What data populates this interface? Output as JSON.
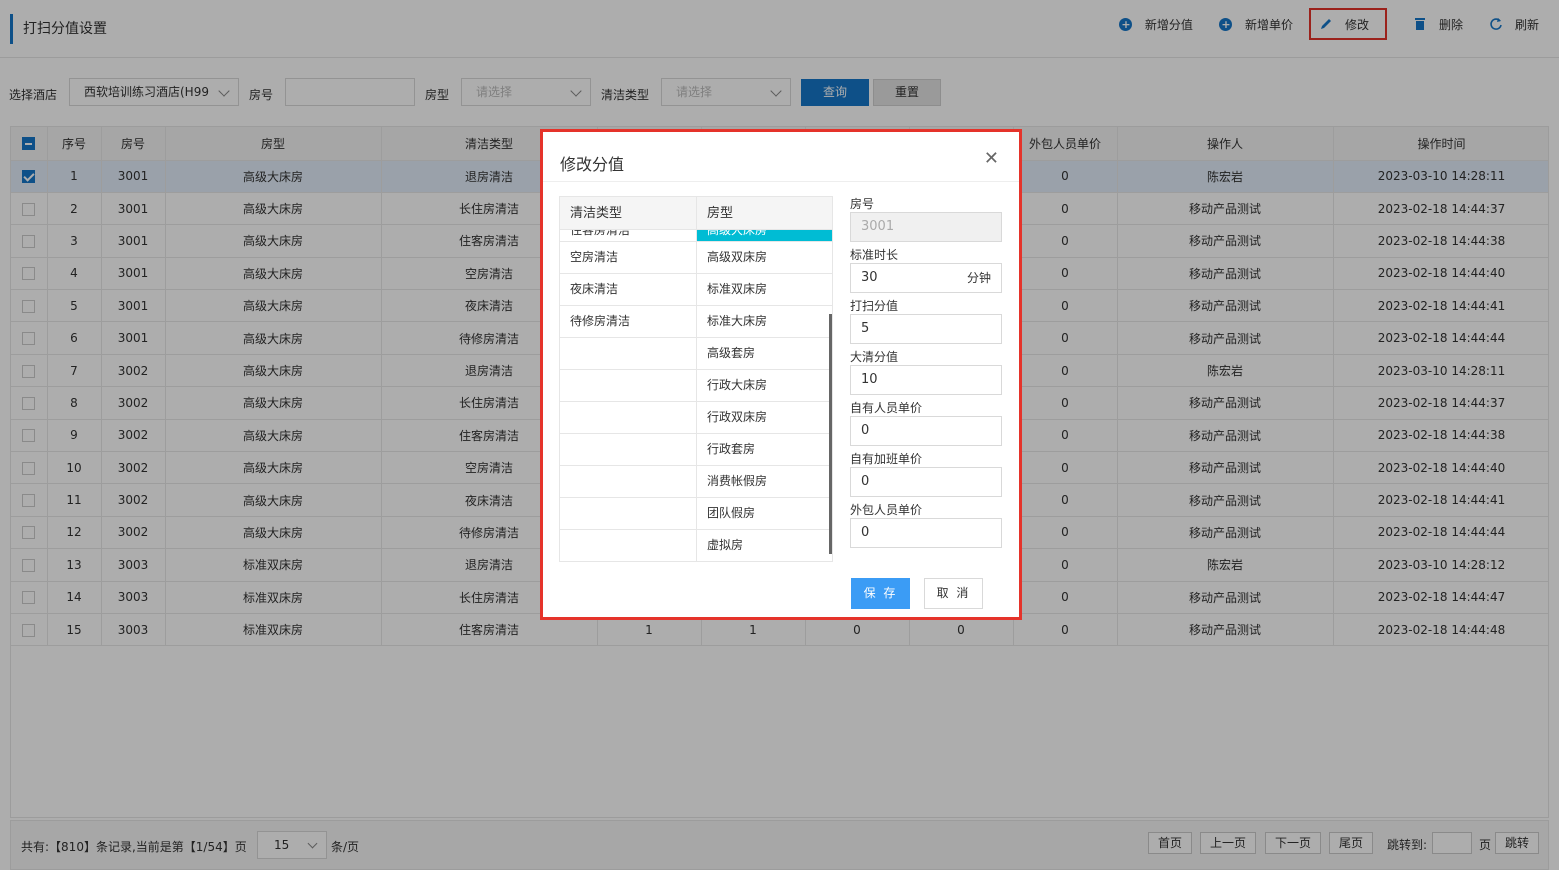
{
  "page": {
    "title": "打扫分值设置"
  },
  "toolbar": {
    "add_score": "新增分值",
    "add_price": "新增单价",
    "edit": "修改",
    "delete": "删除",
    "refresh": "刷新"
  },
  "filter": {
    "hotel_label": "选择酒店",
    "hotel_value": "西软培训练习酒店(H99",
    "room_label": "房号",
    "room_value": "",
    "roomtype_label": "房型",
    "roomtype_placeholder": "请选择",
    "cleantype_label": "清洁类型",
    "cleantype_placeholder": "请选择",
    "query": "查询",
    "reset": "重置"
  },
  "table": {
    "headers": [
      "序号",
      "房号",
      "房型",
      "清洁类型",
      "",
      "",
      "",
      "",
      "外包人员单价",
      "操作人",
      "操作时间"
    ],
    "rows": [
      {
        "no": "1",
        "room": "3001",
        "type": "高级大床房",
        "clean": "退房清洁",
        "c1": "",
        "c2": "",
        "c3": "",
        "c4": "",
        "out": "0",
        "op": "陈宏岩",
        "time": "2023-03-10 14:28:11",
        "checked": true
      },
      {
        "no": "2",
        "room": "3001",
        "type": "高级大床房",
        "clean": "长住房清洁",
        "c1": "",
        "c2": "",
        "c3": "",
        "c4": "",
        "out": "0",
        "op": "移动产品测试",
        "time": "2023-02-18 14:44:37",
        "checked": false
      },
      {
        "no": "3",
        "room": "3001",
        "type": "高级大床房",
        "clean": "住客房清洁",
        "c1": "",
        "c2": "",
        "c3": "",
        "c4": "",
        "out": "0",
        "op": "移动产品测试",
        "time": "2023-02-18 14:44:38",
        "checked": false
      },
      {
        "no": "4",
        "room": "3001",
        "type": "高级大床房",
        "clean": "空房清洁",
        "c1": "",
        "c2": "",
        "c3": "",
        "c4": "",
        "out": "0",
        "op": "移动产品测试",
        "time": "2023-02-18 14:44:40",
        "checked": false
      },
      {
        "no": "5",
        "room": "3001",
        "type": "高级大床房",
        "clean": "夜床清洁",
        "c1": "",
        "c2": "",
        "c3": "",
        "c4": "",
        "out": "0",
        "op": "移动产品测试",
        "time": "2023-02-18 14:44:41",
        "checked": false
      },
      {
        "no": "6",
        "room": "3001",
        "type": "高级大床房",
        "clean": "待修房清洁",
        "c1": "",
        "c2": "",
        "c3": "",
        "c4": "",
        "out": "0",
        "op": "移动产品测试",
        "time": "2023-02-18 14:44:44",
        "checked": false
      },
      {
        "no": "7",
        "room": "3002",
        "type": "高级大床房",
        "clean": "退房清洁",
        "c1": "",
        "c2": "",
        "c3": "",
        "c4": "",
        "out": "0",
        "op": "陈宏岩",
        "time": "2023-03-10 14:28:11",
        "checked": false
      },
      {
        "no": "8",
        "room": "3002",
        "type": "高级大床房",
        "clean": "长住房清洁",
        "c1": "",
        "c2": "",
        "c3": "",
        "c4": "",
        "out": "0",
        "op": "移动产品测试",
        "time": "2023-02-18 14:44:37",
        "checked": false
      },
      {
        "no": "9",
        "room": "3002",
        "type": "高级大床房",
        "clean": "住客房清洁",
        "c1": "",
        "c2": "",
        "c3": "",
        "c4": "",
        "out": "0",
        "op": "移动产品测试",
        "time": "2023-02-18 14:44:38",
        "checked": false
      },
      {
        "no": "10",
        "room": "3002",
        "type": "高级大床房",
        "clean": "空房清洁",
        "c1": "",
        "c2": "",
        "c3": "",
        "c4": "",
        "out": "0",
        "op": "移动产品测试",
        "time": "2023-02-18 14:44:40",
        "checked": false
      },
      {
        "no": "11",
        "room": "3002",
        "type": "高级大床房",
        "clean": "夜床清洁",
        "c1": "",
        "c2": "",
        "c3": "",
        "c4": "",
        "out": "0",
        "op": "移动产品测试",
        "time": "2023-02-18 14:44:41",
        "checked": false
      },
      {
        "no": "12",
        "room": "3002",
        "type": "高级大床房",
        "clean": "待修房清洁",
        "c1": "",
        "c2": "",
        "c3": "",
        "c4": "",
        "out": "0",
        "op": "移动产品测试",
        "time": "2023-02-18 14:44:44",
        "checked": false
      },
      {
        "no": "13",
        "room": "3003",
        "type": "标准双床房",
        "clean": "退房清洁",
        "c1": "",
        "c2": "",
        "c3": "",
        "c4": "",
        "out": "0",
        "op": "陈宏岩",
        "time": "2023-03-10 14:28:12",
        "checked": false
      },
      {
        "no": "14",
        "room": "3003",
        "type": "标准双床房",
        "clean": "长住房清洁",
        "c1": "",
        "c2": "",
        "c3": "",
        "c4": "",
        "out": "0",
        "op": "移动产品测试",
        "time": "2023-02-18 14:44:47",
        "checked": false
      },
      {
        "no": "15",
        "room": "3003",
        "type": "标准双床房",
        "clean": "住客房清洁",
        "c1": "1",
        "c2": "1",
        "c3": "0",
        "c4": "0",
        "out": "0",
        "op": "移动产品测试",
        "time": "2023-02-18 14:44:48",
        "checked": false
      }
    ]
  },
  "footer": {
    "summary": "共有:【810】条记录,当前是第【1/54】页",
    "page_size": "15",
    "unit": "条/页",
    "first": "首页",
    "prev": "上一页",
    "next": "下一页",
    "last": "尾页",
    "jump_label": "跳转到:",
    "page_unit": "页",
    "jump": "跳转"
  },
  "modal": {
    "title": "修改分值",
    "list_headers": [
      "清洁类型",
      "房型"
    ],
    "partial_row": [
      "住客房清洁",
      "高级大床房"
    ],
    "rows": [
      [
        "空房清洁",
        "高级双床房"
      ],
      [
        "夜床清洁",
        "标准双床房"
      ],
      [
        "待修房清洁",
        "标准大床房"
      ],
      [
        "",
        "高级套房"
      ],
      [
        "",
        "行政大床房"
      ],
      [
        "",
        "行政双床房"
      ],
      [
        "",
        "行政套房"
      ],
      [
        "",
        "消费帐假房"
      ],
      [
        "",
        "团队假房"
      ],
      [
        "",
        "虚拟房"
      ]
    ],
    "fields": {
      "room_label": "房号",
      "room_value": "3001",
      "duration_label": "标准时长",
      "duration_value": "30",
      "duration_unit": "分钟",
      "score_label": "打扫分值",
      "score_value": "5",
      "deep_label": "大清分值",
      "deep_value": "10",
      "own_label": "自有人员单价",
      "own_value": "0",
      "overtime_label": "自有加班单价",
      "overtime_value": "0",
      "outsource_label": "外包人员单价",
      "outsource_value": "0"
    },
    "save": "保 存",
    "cancel": "取 消"
  }
}
